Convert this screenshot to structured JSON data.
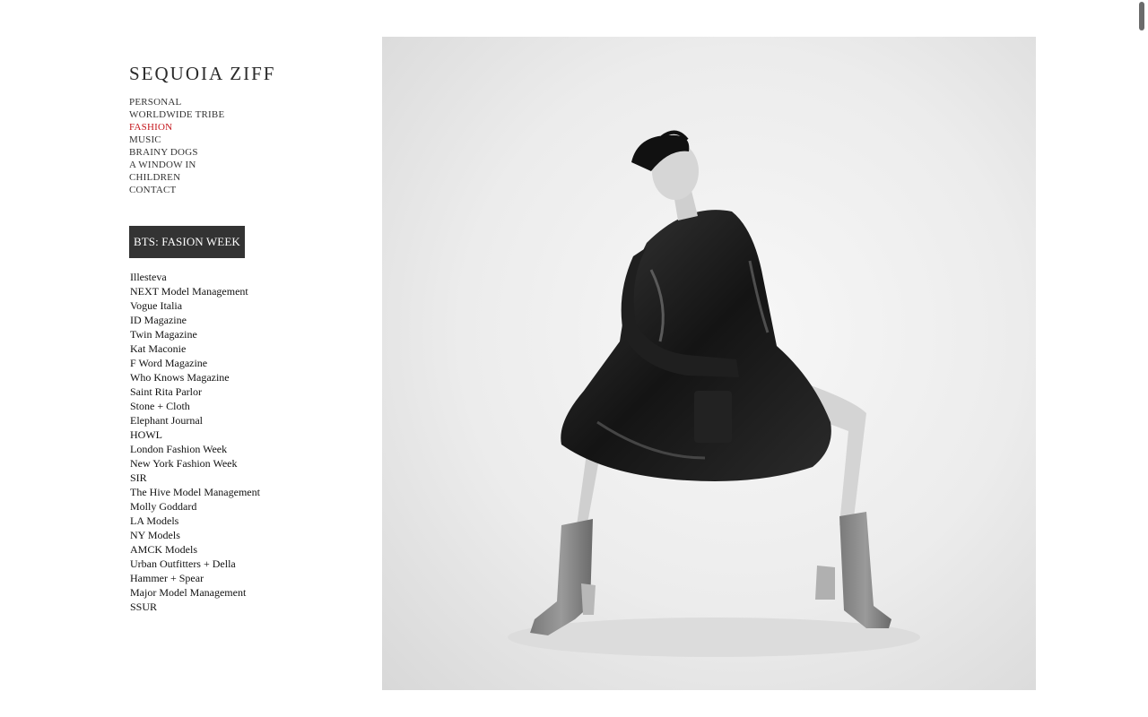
{
  "site": {
    "title": "SEQUOIA ZIFF"
  },
  "main_nav": [
    {
      "label": "PERSONAL",
      "active": false
    },
    {
      "label": "WORLDWIDE TRIBE",
      "active": false
    },
    {
      "label": "FASHION",
      "active": true
    },
    {
      "label": "MUSIC",
      "active": false
    },
    {
      "label": "BRAINY DOGS",
      "active": false
    },
    {
      "label": "A WINDOW IN",
      "active": false
    },
    {
      "label": "CHILDREN",
      "active": false
    },
    {
      "label": "CONTACT",
      "active": false
    }
  ],
  "section": {
    "label": "BTS: FASION WEEK"
  },
  "sub_nav": [
    "Illesteva",
    "NEXT Model Management",
    "Vogue Italia",
    "ID Magazine",
    "Twin Magazine",
    "Kat Maconie",
    "F Word Magazine",
    "Who Knows Magazine",
    "Saint Rita Parlor",
    "Stone + Cloth",
    "Elephant Journal",
    "HOWL",
    "London Fashion Week",
    "New York Fashion Week",
    "SIR",
    "The Hive Model Management",
    "Molly Goddard",
    "LA Models",
    "NY Models",
    "AMCK Models",
    "Urban Outfitters + Della",
    "Hammer + Spear",
    "Major Model Management",
    "SSUR"
  ],
  "colors": {
    "active_nav": "#c4161c",
    "badge_bg": "#333333"
  },
  "photo": {
    "style": "black-and-white fashion portrait"
  }
}
